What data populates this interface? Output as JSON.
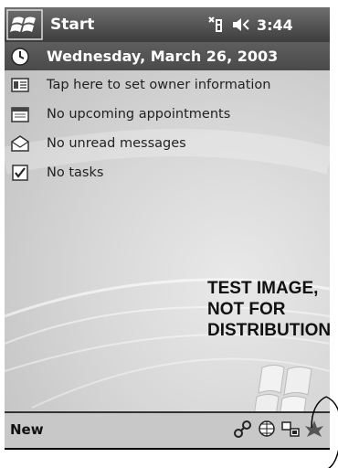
{
  "titlebar": {
    "start_label": "Start",
    "clock": "3:44",
    "icons": [
      "windows-flag-icon",
      "connectivity-icon",
      "speaker-icon"
    ]
  },
  "today": {
    "date": "Wednesday, March 26, 2003",
    "owner": "Tap here to set owner information",
    "appointments": "No upcoming appointments",
    "messages": "No unread messages",
    "tasks": "No tasks"
  },
  "watermark": {
    "line1": "TEST IMAGE,",
    "line2": "NOT FOR",
    "line3": "DISTRIBUTION"
  },
  "menubar": {
    "new_label": "New",
    "icons": [
      "network-connection-icon",
      "sync-icon",
      "activesync-icon",
      "notification-icon"
    ]
  },
  "colors": {
    "titlebar": "#4a4a4a",
    "background": "#d6d6d6",
    "menubar": "#c8c8c8"
  }
}
